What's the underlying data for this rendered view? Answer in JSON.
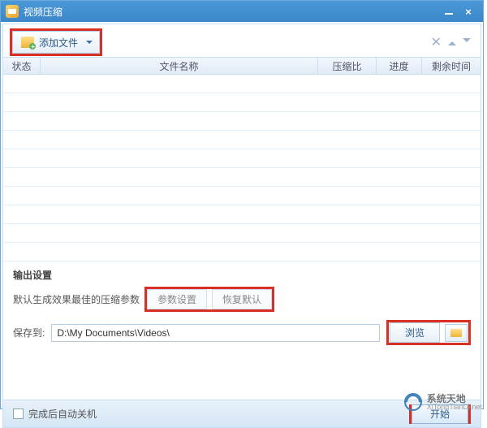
{
  "window": {
    "title": "视频压缩"
  },
  "toolbar": {
    "add_label": "添加文件"
  },
  "columns": {
    "state": "状态",
    "name": "文件名称",
    "ratio": "压缩比",
    "progress": "进度",
    "remaining": "剩余时间"
  },
  "output": {
    "section_title": "输出设置",
    "param_hint": "默认生成效果最佳的压缩参数",
    "param_settings_label": "参数设置",
    "restore_default_label": "恢复默认",
    "save_to_label": "保存到:",
    "save_path": "D:\\My Documents\\Videos\\",
    "browse_label": "浏览"
  },
  "footer": {
    "shutdown_label": "完成后自动关机",
    "start_label": "开始"
  },
  "watermark": {
    "main": "系统天地",
    "sub": "XiTongTianDi.net"
  }
}
